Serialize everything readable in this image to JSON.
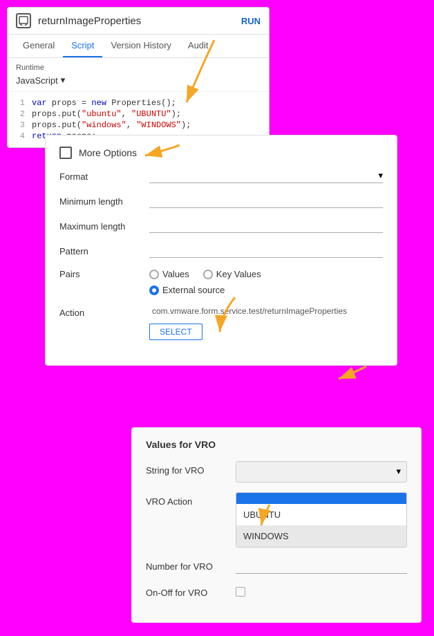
{
  "app": {
    "title": "returnImageProperties",
    "run_label": "RUN",
    "icon": "⊡"
  },
  "tabs": [
    {
      "label": "General",
      "active": false
    },
    {
      "label": "Script",
      "active": true
    },
    {
      "label": "Version History",
      "active": false
    },
    {
      "label": "Audit",
      "active": false
    }
  ],
  "runtime": {
    "label": "Runtime",
    "value": "JavaScript"
  },
  "code_lines": [
    {
      "num": "1",
      "code": "var props = new Properties();"
    },
    {
      "num": "2",
      "code": "props.put(\"ubuntu\", \"UBUNTU\");"
    },
    {
      "num": "3",
      "code": "props.put(\"windows\", \"WINDOWS\");"
    },
    {
      "num": "4",
      "code": "return props;"
    }
  ],
  "more_options": {
    "title": "More Options",
    "checkbox_checked": false,
    "fields": [
      {
        "label": "Format",
        "type": "select",
        "value": ""
      },
      {
        "label": "Minimum length",
        "type": "input",
        "value": ""
      },
      {
        "label": "Maximum length",
        "type": "input",
        "value": ""
      },
      {
        "label": "Pattern",
        "type": "input",
        "value": ""
      }
    ],
    "pairs_label": "Pairs",
    "pairs_options": [
      {
        "label": "Values",
        "selected": false
      },
      {
        "label": "Key Values",
        "selected": false
      },
      {
        "label": "External source",
        "selected": true
      }
    ],
    "action_label": "Action",
    "action_value": "com.vmware.form.service.test/returnImageProperties",
    "select_btn": "SELECT"
  },
  "vro": {
    "title": "Values for VRO",
    "fields": [
      {
        "label": "String for VRO",
        "type": "dropdown"
      },
      {
        "label": "VRO Action",
        "type": "dropdown_open",
        "options": [
          {
            "label": "",
            "highlighted": true
          },
          {
            "label": "UBUNTU",
            "highlighted": false
          },
          {
            "label": "WINDOWS",
            "highlighted": false
          }
        ]
      },
      {
        "label": "Number for VRO",
        "type": "input"
      },
      {
        "label": "On-Off for VRO",
        "type": "checkbox"
      }
    ]
  }
}
